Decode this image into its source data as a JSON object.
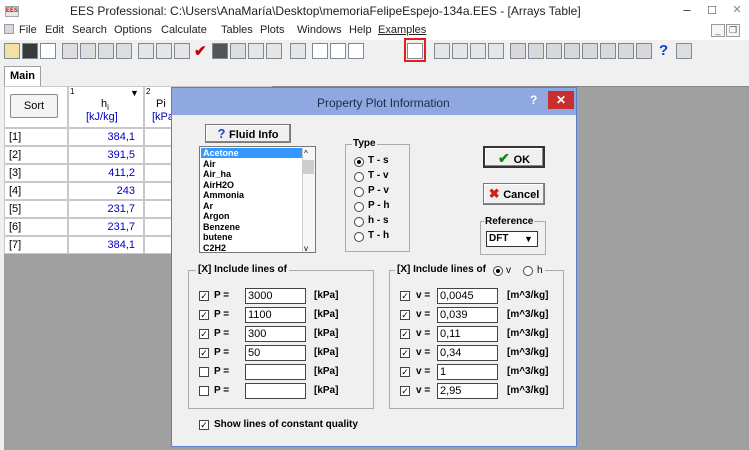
{
  "window": {
    "title": "EES Professional:  C:\\Users\\AnaMaría\\Desktop\\memoriaFelipeEspejo-134a.EES - [Arrays Table]",
    "app_icon": "EES",
    "minimize": "–",
    "maximize": "□",
    "close": "✕"
  },
  "menu": [
    "File",
    "Edit",
    "Search",
    "Options",
    "Calculate",
    "Tables",
    "Plots",
    "Windows",
    "Help",
    "Examples"
  ],
  "tab": "Main",
  "table": {
    "sort_label": "Sort",
    "col1_index": "1",
    "col1_name": "hi",
    "col1_sub": "i",
    "col1_unit": "[kJ/kg]",
    "col2_index": "2",
    "col2_name": "Pi",
    "col2_unit": "[kPa]",
    "rows": [
      {
        "label": "[1]",
        "value": "384,1"
      },
      {
        "label": "[2]",
        "value": "391,5"
      },
      {
        "label": "[3]",
        "value": "411,2"
      },
      {
        "label": "[4]",
        "value": "243"
      },
      {
        "label": "[5]",
        "value": "231,7"
      },
      {
        "label": "[6]",
        "value": "231,7"
      },
      {
        "label": "[7]",
        "value": "384,1"
      }
    ]
  },
  "dialog": {
    "title": "Property Plot Information",
    "help": "?",
    "close": "✕",
    "fluid_info": "Fluid Info",
    "fluids": [
      "Acetone",
      "Air",
      "Air_ha",
      "AirH2O",
      "Ammonia",
      "Ar",
      "Argon",
      "Benzene",
      "butene",
      "C2H2"
    ],
    "type_label": "Type",
    "types": [
      {
        "label": "T - s",
        "on": true
      },
      {
        "label": "T - v",
        "on": false
      },
      {
        "label": "P - v",
        "on": false
      },
      {
        "label": "P - h",
        "on": false
      },
      {
        "label": "h - s",
        "on": false
      },
      {
        "label": "T - h",
        "on": false
      }
    ],
    "ok": "OK",
    "cancel": "Cancel",
    "reference_label": "Reference",
    "reference_value": "DFT",
    "left_group_label": "[X] Include lines of",
    "right_group_label": "[X] Include lines of",
    "radio_v": "v",
    "radio_h": "h",
    "p_lines": [
      {
        "checked": true,
        "label": "P =",
        "value": "3000",
        "unit": "[kPa]"
      },
      {
        "checked": true,
        "label": "P =",
        "value": "1100",
        "unit": "[kPa]"
      },
      {
        "checked": true,
        "label": "P =",
        "value": "300",
        "unit": "[kPa]"
      },
      {
        "checked": true,
        "label": "P =",
        "value": "50",
        "unit": "[kPa]"
      },
      {
        "checked": false,
        "label": "P =",
        "value": "",
        "unit": "[kPa]"
      },
      {
        "checked": false,
        "label": "P =",
        "value": "",
        "unit": "[kPa]"
      }
    ],
    "v_lines": [
      {
        "checked": true,
        "label": "v =",
        "value": "0,0045",
        "unit": "[m^3/kg]"
      },
      {
        "checked": true,
        "label": "v =",
        "value": "0,039",
        "unit": "[m^3/kg]"
      },
      {
        "checked": true,
        "label": "v =",
        "value": "0,11",
        "unit": "[m^3/kg]"
      },
      {
        "checked": true,
        "label": "v =",
        "value": "0,34",
        "unit": "[m^3/kg]"
      },
      {
        "checked": true,
        "label": "v =",
        "value": "1",
        "unit": "[m^3/kg]"
      },
      {
        "checked": true,
        "label": "v =",
        "value": "2,95",
        "unit": "[m^3/kg]"
      }
    ],
    "quality_label": "Show lines of constant quality"
  }
}
